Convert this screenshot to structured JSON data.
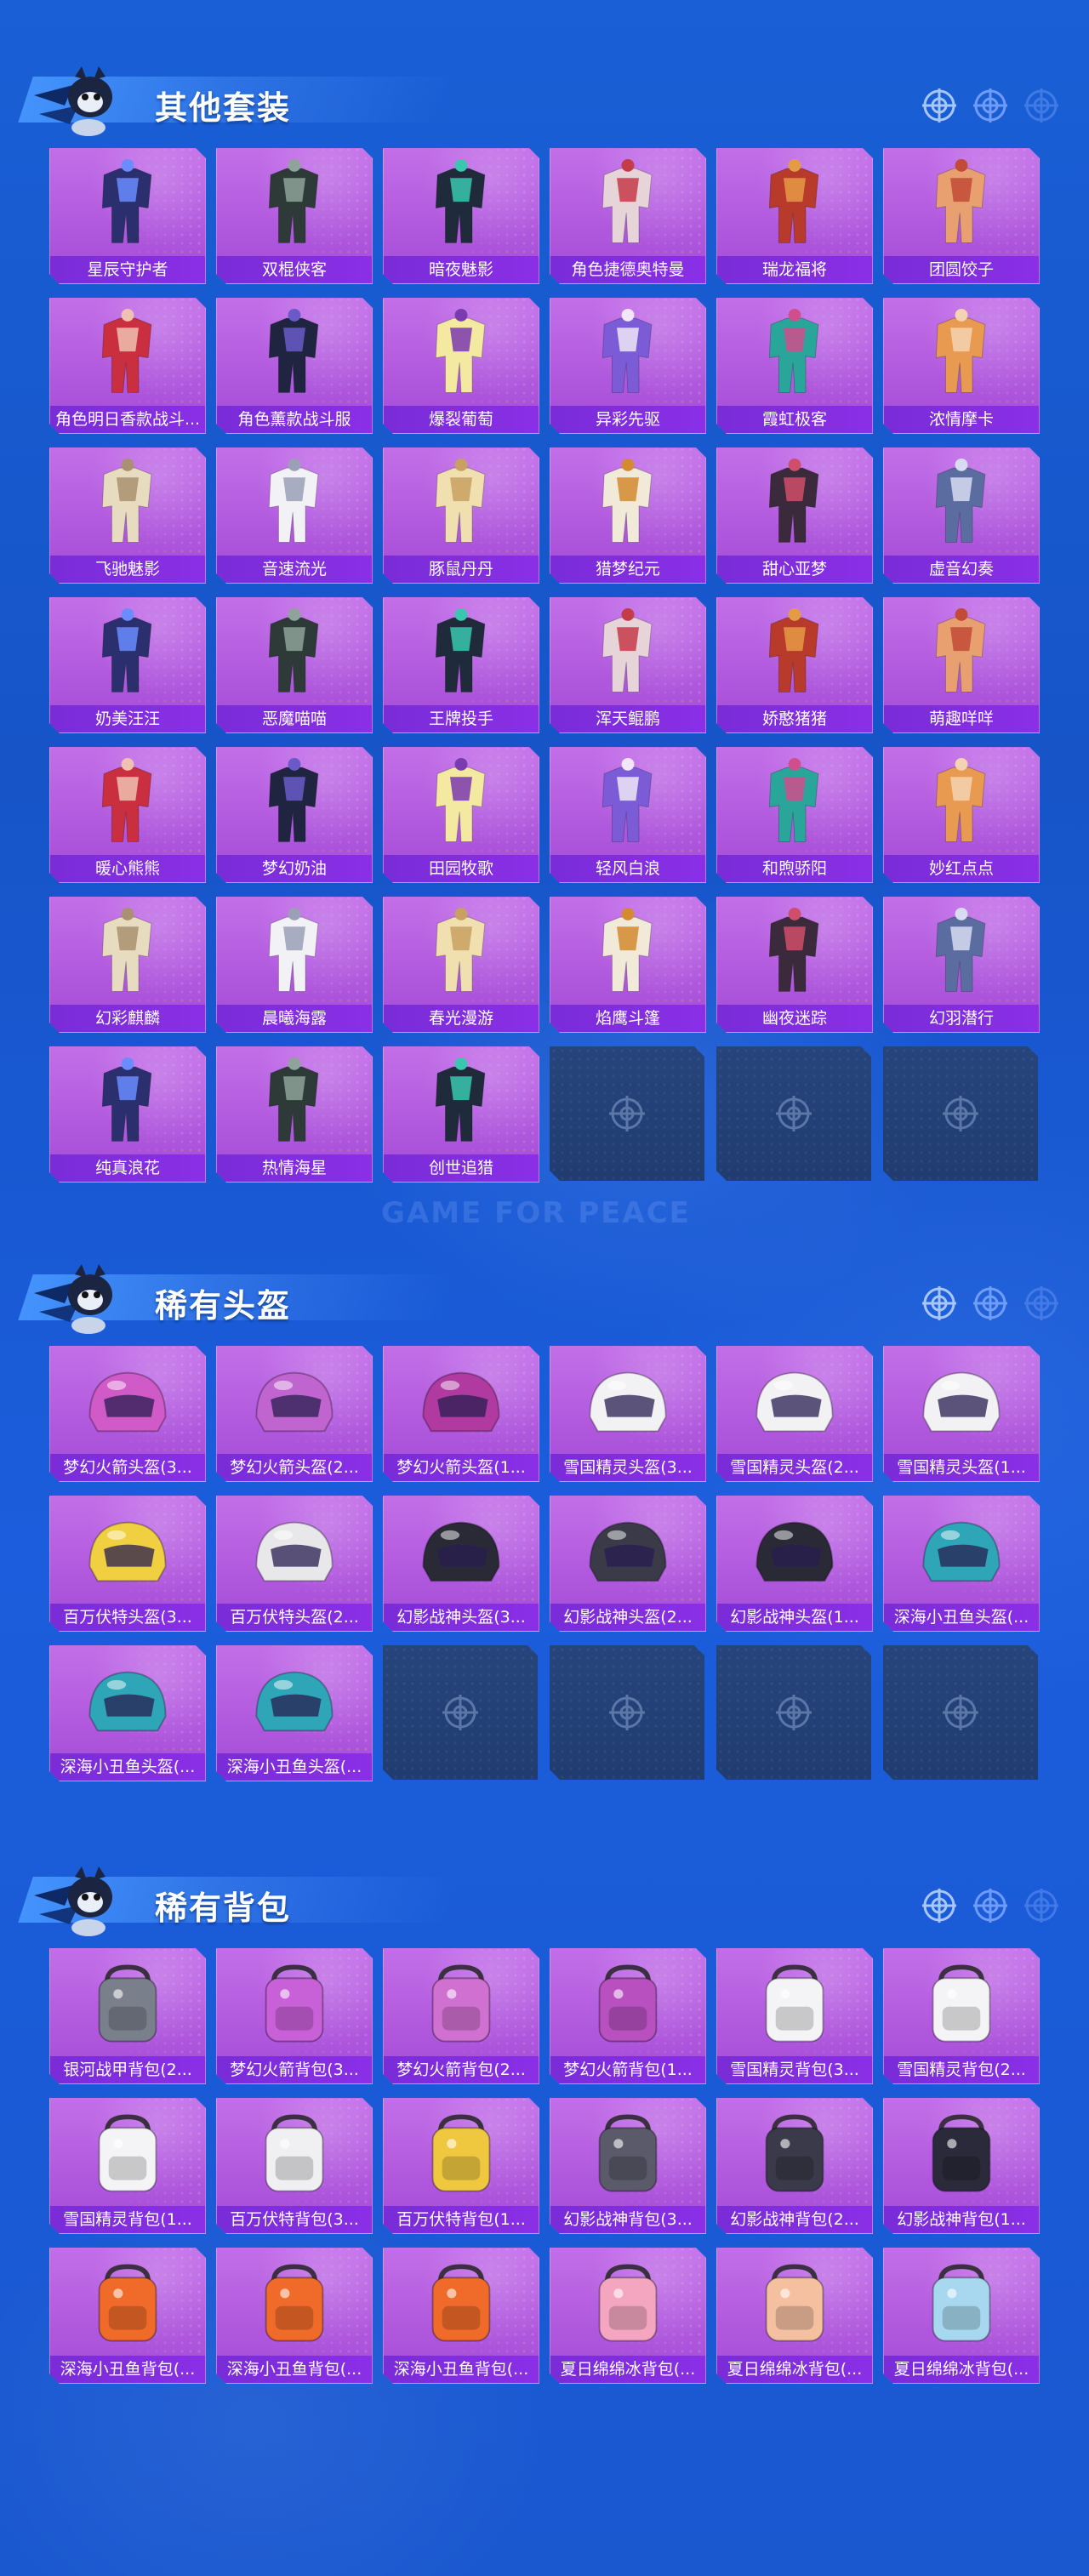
{
  "sections": [
    {
      "title": "其他套装",
      "cols": 6,
      "empty_slots": 3,
      "items": [
        {
          "label": "星辰守护者",
          "icon": "outfit-icon"
        },
        {
          "label": "双棍侠客",
          "icon": "outfit-icon"
        },
        {
          "label": "暗夜魅影",
          "icon": "outfit-icon"
        },
        {
          "label": "角色捷德奥特曼",
          "icon": "outfit-icon"
        },
        {
          "label": "瑞龙福将",
          "icon": "outfit-icon"
        },
        {
          "label": "团圆饺子",
          "icon": "outfit-icon"
        },
        {
          "label": "角色明日香款战斗...",
          "icon": "outfit-icon"
        },
        {
          "label": "角色薰款战斗服",
          "icon": "outfit-icon"
        },
        {
          "label": "爆裂葡萄",
          "icon": "outfit-icon"
        },
        {
          "label": "异彩先驱",
          "icon": "outfit-icon"
        },
        {
          "label": "霞虹极客",
          "icon": "outfit-icon"
        },
        {
          "label": "浓情摩卡",
          "icon": "outfit-icon"
        },
        {
          "label": "飞驰魅影",
          "icon": "outfit-icon"
        },
        {
          "label": "音速流光",
          "icon": "outfit-icon"
        },
        {
          "label": "豚鼠丹丹",
          "icon": "outfit-icon"
        },
        {
          "label": "猎梦纪元",
          "icon": "outfit-icon"
        },
        {
          "label": "甜心亚梦",
          "icon": "outfit-icon"
        },
        {
          "label": "虚音幻奏",
          "icon": "outfit-icon"
        },
        {
          "label": "奶美汪汪",
          "icon": "outfit-icon"
        },
        {
          "label": "恶魔喵喵",
          "icon": "outfit-icon"
        },
        {
          "label": "王牌投手",
          "icon": "outfit-icon"
        },
        {
          "label": "浑天鲲鹏",
          "icon": "outfit-icon"
        },
        {
          "label": "娇憨猪猪",
          "icon": "outfit-icon"
        },
        {
          "label": "萌趣咩咩",
          "icon": "outfit-icon"
        },
        {
          "label": "暖心熊熊",
          "icon": "outfit-icon"
        },
        {
          "label": "梦幻奶油",
          "icon": "outfit-icon"
        },
        {
          "label": "田园牧歌",
          "icon": "outfit-icon"
        },
        {
          "label": "轻风白浪",
          "icon": "outfit-icon"
        },
        {
          "label": "和煦骄阳",
          "icon": "outfit-icon"
        },
        {
          "label": "妙红点点",
          "icon": "outfit-icon"
        },
        {
          "label": "幻彩麒麟",
          "icon": "outfit-icon"
        },
        {
          "label": "晨曦海露",
          "icon": "outfit-icon"
        },
        {
          "label": "春光漫游",
          "icon": "outfit-icon"
        },
        {
          "label": "焰鹰斗篷",
          "icon": "outfit-icon"
        },
        {
          "label": "幽夜迷踪",
          "icon": "outfit-icon"
        },
        {
          "label": "幻羽潜行",
          "icon": "outfit-icon"
        },
        {
          "label": "纯真浪花",
          "icon": "outfit-icon"
        },
        {
          "label": "热情海星",
          "icon": "outfit-icon"
        },
        {
          "label": "创世追猎",
          "icon": "outfit-icon"
        }
      ]
    },
    {
      "title": "稀有头盔",
      "cols": 6,
      "empty_slots": 4,
      "items": [
        {
          "label": "梦幻火箭头盔(3...",
          "icon": "helmet-icon"
        },
        {
          "label": "梦幻火箭头盔(2...",
          "icon": "helmet-icon"
        },
        {
          "label": "梦幻火箭头盔(1...",
          "icon": "helmet-icon"
        },
        {
          "label": "雪国精灵头盔(3...",
          "icon": "helmet-icon"
        },
        {
          "label": "雪国精灵头盔(2...",
          "icon": "helmet-icon"
        },
        {
          "label": "雪国精灵头盔(1...",
          "icon": "helmet-icon"
        },
        {
          "label": "百万伏特头盔(3...",
          "icon": "helmet-icon"
        },
        {
          "label": "百万伏特头盔(2...",
          "icon": "helmet-icon"
        },
        {
          "label": "幻影战神头盔(3...",
          "icon": "helmet-icon"
        },
        {
          "label": "幻影战神头盔(2...",
          "icon": "helmet-icon"
        },
        {
          "label": "幻影战神头盔(1...",
          "icon": "helmet-icon"
        },
        {
          "label": "深海小丑鱼头盔(...",
          "icon": "helmet-icon"
        },
        {
          "label": "深海小丑鱼头盔(...",
          "icon": "helmet-icon"
        },
        {
          "label": "深海小丑鱼头盔(...",
          "icon": "helmet-icon"
        }
      ]
    },
    {
      "title": "稀有背包",
      "cols": 6,
      "empty_slots": 0,
      "items": [
        {
          "label": "银河战甲背包(2...",
          "icon": "backpack-icon"
        },
        {
          "label": "梦幻火箭背包(3...",
          "icon": "backpack-icon"
        },
        {
          "label": "梦幻火箭背包(2...",
          "icon": "backpack-icon"
        },
        {
          "label": "梦幻火箭背包(1...",
          "icon": "backpack-icon"
        },
        {
          "label": "雪国精灵背包(3...",
          "icon": "backpack-icon"
        },
        {
          "label": "雪国精灵背包(2...",
          "icon": "backpack-icon"
        },
        {
          "label": "雪国精灵背包(1...",
          "icon": "backpack-icon"
        },
        {
          "label": "百万伏特背包(3...",
          "icon": "backpack-icon"
        },
        {
          "label": "百万伏特背包(1...",
          "icon": "backpack-icon"
        },
        {
          "label": "幻影战神背包(3...",
          "icon": "backpack-icon"
        },
        {
          "label": "幻影战神背包(2...",
          "icon": "backpack-icon"
        },
        {
          "label": "幻影战神背包(1...",
          "icon": "backpack-icon"
        },
        {
          "label": "深海小丑鱼背包(...",
          "icon": "backpack-icon"
        },
        {
          "label": "深海小丑鱼背包(...",
          "icon": "backpack-icon"
        },
        {
          "label": "深海小丑鱼背包(...",
          "icon": "backpack-icon"
        },
        {
          "label": "夏日绵绵冰背包(...",
          "icon": "backpack-icon"
        },
        {
          "label": "夏日绵绵冰背包(...",
          "icon": "backpack-icon"
        },
        {
          "label": "夏日绵绵冰背包(...",
          "icon": "backpack-icon"
        }
      ]
    }
  ],
  "watermark": "GAME FOR PEACE",
  "colors": {
    "background": "#1a5fd6",
    "card": "#b25ee0",
    "label_bar": "#8230e0",
    "empty_slot": "#24427a",
    "header_band": "#4696ff"
  }
}
